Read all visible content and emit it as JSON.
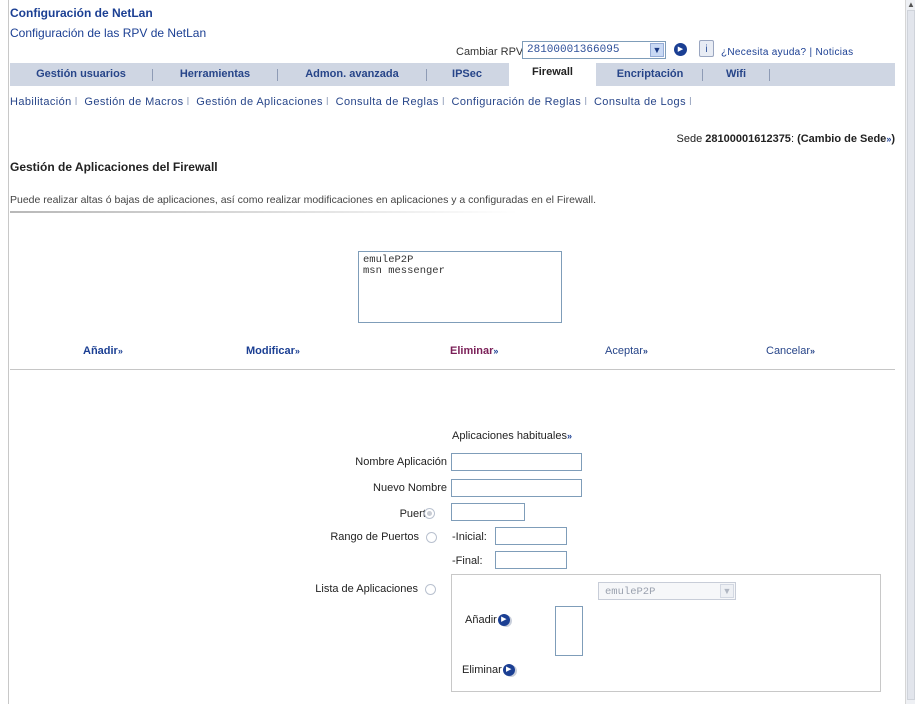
{
  "header": {
    "app_title": "Configuración de NetLan",
    "subtitle": "Configuración de las RPV de NetLan",
    "rpv_label": "Cambiar RPV",
    "rpv_selected": "28100001366095",
    "help_links": "¿Necesita ayuda? | Noticias",
    "info_icon_text": "i"
  },
  "tabs": [
    {
      "label": "Gestión usuarios",
      "active": false
    },
    {
      "label": "Herramientas",
      "active": false
    },
    {
      "label": "Admon. avanzada",
      "active": false
    },
    {
      "label": "IPSec",
      "active": false
    },
    {
      "label": "Firewall",
      "active": true
    },
    {
      "label": "Encriptación",
      "active": false
    },
    {
      "label": "Wifi",
      "active": false
    }
  ],
  "subnav": [
    "Habilitación",
    "Gestión de Macros",
    "Gestión de Aplicaciones",
    "Consulta de Reglas",
    "Configuración de Reglas",
    "Consulta de Logs"
  ],
  "sede": {
    "prefix": "Sede",
    "code": "28100001612375",
    "link": "(Cambio de Sede"
  },
  "section": {
    "title": "Gestión de Aplicaciones del Firewall",
    "description": "Puede realizar altas ó bajas de aplicaciones, así como realizar modificaciones en aplicaciones y a configuradas en el Firewall."
  },
  "applications": [
    "emuleP2P",
    "msn messenger"
  ],
  "actions": {
    "add": "Añadir",
    "modify": "Modificar",
    "delete": "Eliminar",
    "accept": "Aceptar",
    "cancel": "Cancelar"
  },
  "arrow_glyph": "»",
  "form": {
    "habituales": "Aplicaciones habituales",
    "name_label": "Nombre Aplicación",
    "new_name_label": "Nuevo Nombre",
    "port_label": "Puerto",
    "range_label": "Rango de Puertos",
    "initial_label": "-Inicial:",
    "final_label": "-Final:",
    "list_label": "Lista de Aplicaciones",
    "list_select_value": "emuleP2P",
    "list_add": "Añadir",
    "list_delete": "Eliminar"
  },
  "colors": {
    "brand": "#1b3f93",
    "tabbar": "#cfd6e3",
    "delete_action": "#7a1f57"
  }
}
